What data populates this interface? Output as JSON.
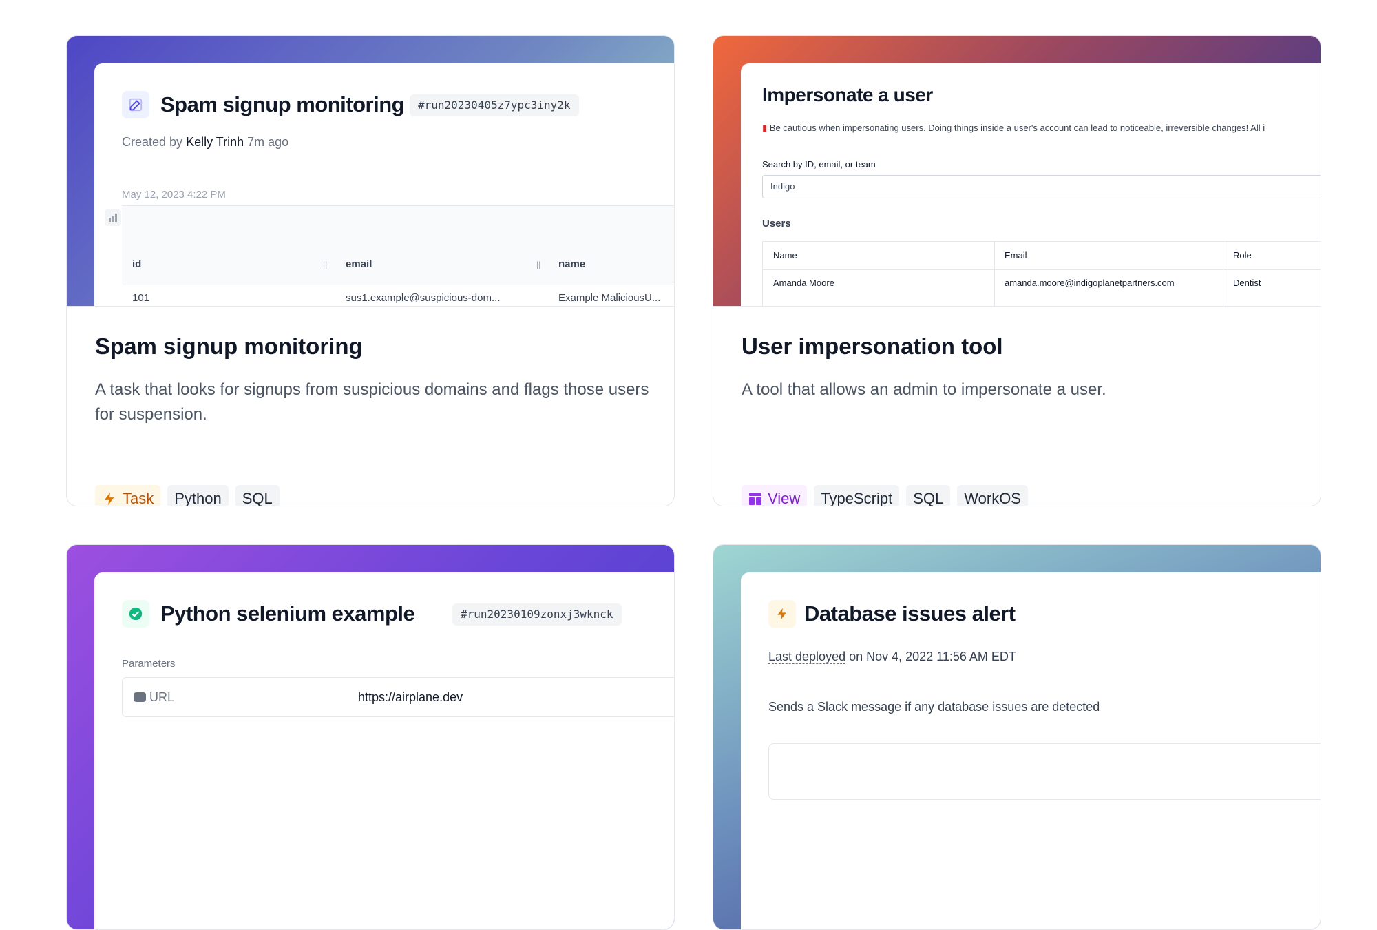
{
  "cards": [
    {
      "preview": {
        "title": "Spam signup monitoring",
        "run_id": "#run20230405z7ypc3iny2k",
        "created_by_prefix": "Created by",
        "created_by_name": "Kelly Trinh",
        "created_ago": "7m ago",
        "timestamp": "May 12, 2023 4:22 PM",
        "columns": [
          "id",
          "email",
          "name"
        ],
        "row": [
          "101",
          "sus1.example@suspicious-dom...",
          "Example MaliciousU..."
        ]
      },
      "title": "Spam signup monitoring",
      "description": "A task that looks for signups from suspicious domains and flags those users for suspension.",
      "tags": [
        "Task",
        "Python",
        "SQL"
      ]
    },
    {
      "preview": {
        "title": "Impersonate a user",
        "warning": "Be cautious when impersonating users. Doing things inside a user's account can lead to noticeable, irreversible changes! All i",
        "search_label": "Search by ID, email, or team",
        "search_value": "Indigo",
        "users_label": "Users",
        "columns": [
          "Name",
          "Email",
          "Role"
        ],
        "row": [
          "Amanda Moore",
          "amanda.moore@indigoplanetpartners.com",
          "Dentist"
        ]
      },
      "title": "User impersonation tool",
      "description": "A tool that allows an admin to impersonate a user.",
      "tags": [
        "View",
        "TypeScript",
        "SQL",
        "WorkOS"
      ]
    },
    {
      "preview": {
        "title": "Python selenium example",
        "run_id": "#run20230109zonxj3wknck",
        "params_label": "Parameters",
        "param_name": "URL",
        "param_value": "https://airplane.dev"
      }
    },
    {
      "preview": {
        "title": "Database issues alert",
        "deployed_link": "Last deployed",
        "deployed_rest": "on Nov 4, 2022 11:56 AM EDT",
        "description": "Sends a Slack message if any database issues are detected"
      }
    }
  ],
  "colors": {
    "task_accent": "#b45309",
    "view_accent": "#7e22ce",
    "success": "#10b981"
  }
}
